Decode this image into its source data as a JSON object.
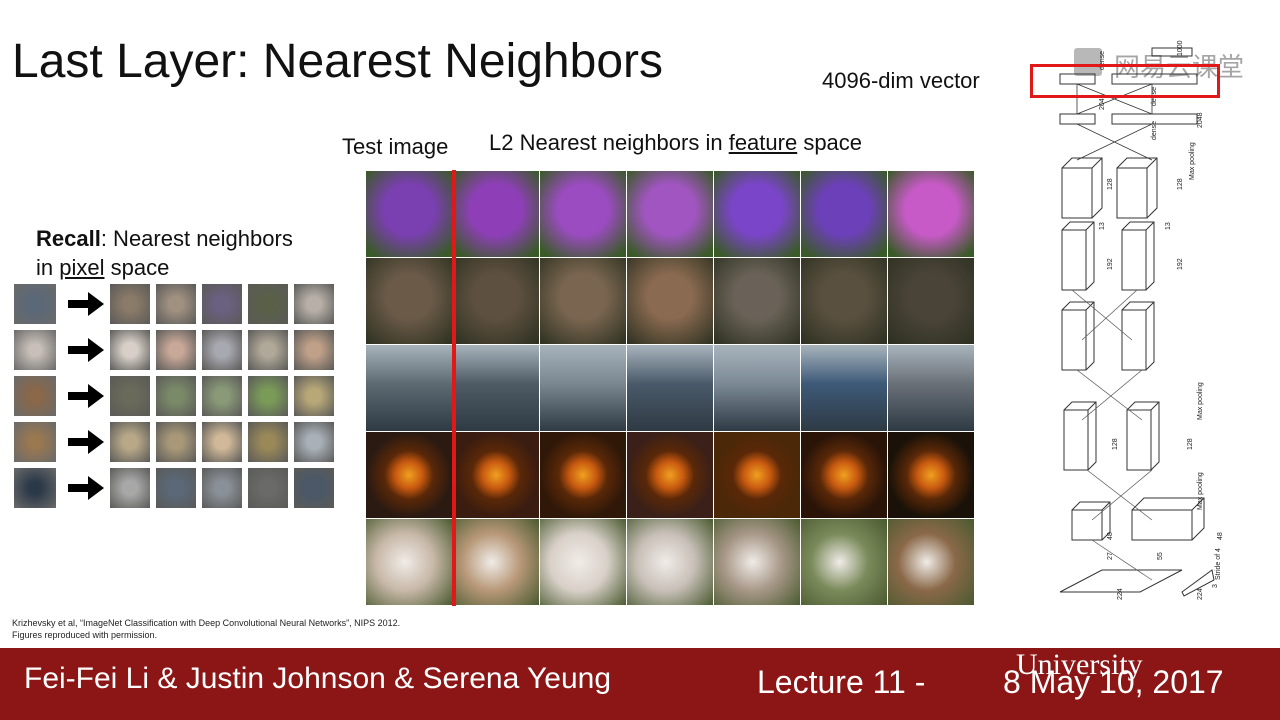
{
  "slide": {
    "title": "Last Layer: Nearest Neighbors",
    "vector_label": "4096-dim vector",
    "test_image_label": "Test image",
    "nn_label_prefix": "L2 Nearest neighbors in ",
    "nn_label_underlined": "feature",
    "nn_label_suffix": " space",
    "recall_bold": "Recall",
    "recall_rest": ": Nearest neighbors",
    "recall_line2_prefix": "in ",
    "recall_line2_underlined": "pixel",
    "recall_line2_suffix": " space",
    "credit_line1": "Krizhevsky et al, “ImageNet Classification with Deep Convolutional Neural Networks”, NIPS 2012.",
    "credit_line2": "Figures reproduced with permission."
  },
  "feature_rows": [
    {
      "subject": "flower",
      "colors": [
        "#7a3fb0",
        "#8e3fb8",
        "#9a4cc0",
        "#a055c0",
        "#7a45c8",
        "#6c40b8",
        "#c85ac8"
      ]
    },
    {
      "subject": "elephant",
      "colors": [
        "#6b5a48",
        "#5e5040",
        "#7a6650",
        "#8a6a50",
        "#6a6258",
        "#5a5040",
        "#4a4438"
      ]
    },
    {
      "subject": "aircraft carrier",
      "colors": [
        "#5e6a72",
        "#4e5a64",
        "#7a8690",
        "#4a5a6a",
        "#7c8a96",
        "#3e5a78",
        "#6a7078"
      ]
    },
    {
      "subject": "jack-o-lantern",
      "colors": [
        "#2a1a12",
        "#3a1c10",
        "#301808",
        "#3a2018",
        "#4a2808",
        "#2a1408",
        "#1a1208"
      ]
    },
    {
      "subject": "dog",
      "colors": [
        "#c8b8a8",
        "#b89878",
        "#d8d0c8",
        "#c8c0b8",
        "#a89888",
        "#7a8a5a",
        "#8a6848"
      ]
    }
  ],
  "pixel_rows": [
    {
      "query": "#5a6878",
      "neighbors": [
        "#8a7a68",
        "#a09080",
        "#6a6080",
        "#5a6048",
        "#b8b0a8"
      ]
    },
    {
      "query": "#c8c0b8",
      "neighbors": [
        "#d8d0c8",
        "#c8a898",
        "#a8a8b0",
        "#b0a898",
        "#c0a088"
      ]
    },
    {
      "query": "#8a6848",
      "neighbors": [
        "#6a6a5a",
        "#7a8a68",
        "#8a9a78",
        "#7a9a58",
        "#b8a878"
      ]
    },
    {
      "query": "#9a7850",
      "neighbors": [
        "#b8a888",
        "#a89878",
        "#d0b898",
        "#9a8858",
        "#a8b0b8"
      ]
    },
    {
      "query": "#2a3848",
      "neighbors": [
        "#a8a8a8",
        "#5a6878",
        "#8a9098",
        "#6a6a68",
        "#4a5868"
      ]
    }
  ],
  "network": {
    "labels": [
      "dense",
      "dense",
      "dense",
      "1000",
      "2048",
      "2048",
      "Max pooling",
      "Max pooling",
      "Max pooling",
      "128",
      "128",
      "192",
      "192",
      "128",
      "128",
      "48",
      "48",
      "27",
      "55",
      "224",
      "224",
      "Stride of 4",
      "13",
      "13",
      "3"
    ]
  },
  "footer": {
    "names": "Fei-Fei Li & Justin Johnson & Serena Yeung",
    "lecture": "Lecture 11 -",
    "date": "8   May 10, 2017",
    "university": "University"
  },
  "watermark": "网易云课堂"
}
